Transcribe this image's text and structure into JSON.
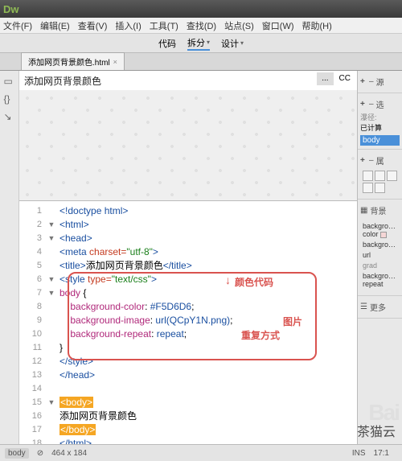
{
  "app": {
    "logo": "Dw",
    "logo_sub": ""
  },
  "menu": [
    "文件(F)",
    "编辑(E)",
    "查看(V)",
    "插入(I)",
    "工具(T)",
    "查找(D)",
    "站点(S)",
    "窗口(W)",
    "帮助(H)"
  ],
  "viewbar": {
    "code": "代码",
    "split": "拆分",
    "design": "设计"
  },
  "tab": {
    "name": "添加网页背景颜色.html",
    "dirty": "×"
  },
  "preview": {
    "title": "添加网页背景颜色"
  },
  "righttabs": {
    "a": "...",
    "b": "CC"
  },
  "code_lines": [
    {
      "n": "1",
      "fold": "",
      "html": "<span class='t-tag'>&lt;!doctype html&gt;</span>"
    },
    {
      "n": "2",
      "fold": "▼",
      "html": "<span class='t-tag'>&lt;html&gt;</span>"
    },
    {
      "n": "3",
      "fold": "▼",
      "html": "<span class='t-tag'>&lt;head&gt;</span>"
    },
    {
      "n": "4",
      "fold": "",
      "html": "<span class='t-tag'>&lt;meta</span> <span class='t-attr'>charset=</span><span class='t-str'>\"utf-8\"</span><span class='t-tag'>&gt;</span>"
    },
    {
      "n": "5",
      "fold": "",
      "html": "<span class='t-tag'>&lt;title&gt;</span>添加网页背景颜色<span class='t-tag'>&lt;/title&gt;</span>"
    },
    {
      "n": "6",
      "fold": "▼",
      "html": "<span class='t-tag'>&lt;style</span> <span class='t-attr'>type=</span><span class='t-str'>\"text/css\"</span><span class='t-tag'>&gt;</span>"
    },
    {
      "n": "7",
      "fold": "▼",
      "html": "<span class='t-sel'>body</span> {"
    },
    {
      "n": "8",
      "fold": "",
      "html": "    <span class='t-css'>background-color</span>: <span class='t-val'>#F5D6D6</span>;"
    },
    {
      "n": "9",
      "fold": "",
      "html": "    <span class='t-css'>background-image</span>: <span class='t-val'>url(QCpY1N.png)</span>;"
    },
    {
      "n": "10",
      "fold": "",
      "html": "    <span class='t-css'>background-repeat</span>: <span class='t-val'>repeat</span>;"
    },
    {
      "n": "11",
      "fold": "",
      "html": "}"
    },
    {
      "n": "12",
      "fold": "",
      "html": "<span class='t-tag'>&lt;/style&gt;</span>"
    },
    {
      "n": "13",
      "fold": "",
      "html": "<span class='t-tag'>&lt;/head&gt;</span>"
    },
    {
      "n": "14",
      "fold": "",
      "html": ""
    },
    {
      "n": "15",
      "fold": "▼",
      "html": "<span class='hl'>&lt;body&gt;</span>"
    },
    {
      "n": "16",
      "fold": "",
      "html": "添加网页背景颜色"
    },
    {
      "n": "17",
      "fold": "",
      "html": "<span class='hl'>&lt;/body&gt;</span>"
    },
    {
      "n": "18",
      "fold": "",
      "html": "<span class='t-tag'>&lt;/html&gt;</span>"
    }
  ],
  "annotations": {
    "color": "颜色代码",
    "image": "图片",
    "repeat": "重复方式"
  },
  "right": {
    "src": "源",
    "sel": "选",
    "crumb": "瀑径:",
    "computed": "已计算",
    "body": "body",
    "props_title": "属",
    "bg": "背景",
    "props": [
      {
        "k": "background-color",
        "v": ""
      },
      {
        "k": "background-",
        "v": ""
      },
      {
        "k": "url",
        "v": ""
      },
      {
        "k": "grad",
        "v": ""
      },
      {
        "k": "background-repeat",
        "v": ""
      }
    ],
    "more": "更多"
  },
  "status": {
    "tag": "body",
    "dim": "464 x 184",
    "ins": "INS",
    "rc": "17:1",
    "enc": ""
  },
  "watermark": "茶猫云"
}
